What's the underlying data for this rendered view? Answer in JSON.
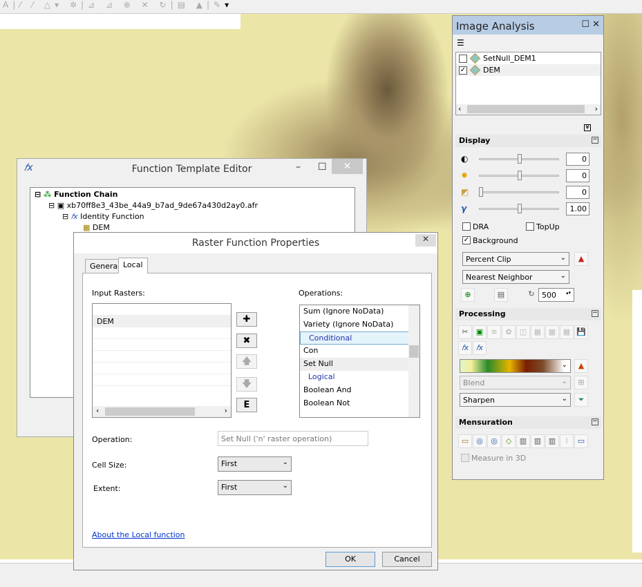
{
  "toolbar": {
    "icons": [
      "text-tool",
      "line-tool",
      "curve-tool",
      "polygon-tool",
      "sparkle-tool",
      "edit-vertices",
      "reshape",
      "move",
      "cut",
      "rotate",
      "attributes",
      "sketch-properties",
      "editor-menu"
    ],
    "overflow": "▾"
  },
  "image_analysis": {
    "title": "Image Analysis",
    "layers": [
      {
        "name": "SetNull_DEM1",
        "checked": false
      },
      {
        "name": "DEM",
        "checked": true
      }
    ],
    "display": {
      "title": "Display",
      "sliders": [
        {
          "name": "contrast",
          "value": "0",
          "level": 0.5
        },
        {
          "name": "brightness",
          "value": "0",
          "level": 0.5
        },
        {
          "name": "transparency",
          "value": "0",
          "level": 0
        },
        {
          "name": "gamma",
          "value": "1.00",
          "level": 0.5
        }
      ],
      "dra_label": "DRA",
      "dra": false,
      "topup_label": "TopUp",
      "topup": false,
      "background_label": "Background",
      "background": true,
      "stretch": "Percent Clip",
      "resampling": "Nearest Neighbor",
      "refresh": "500"
    },
    "processing": {
      "title": "Processing",
      "blend": "Blend",
      "filter": "Sharpen"
    },
    "mensuration": {
      "title": "Mensuration",
      "measure3d_label": "Measure in 3D",
      "measure3d": false
    }
  },
  "fte": {
    "title": "Function Template Editor",
    "tree": [
      "Function Chain",
      "xb70ff8e3_43be_44a9_b7ad_9de67a430d2ay0.afr",
      "Identity Function",
      "DEM"
    ]
  },
  "rfp": {
    "title": "Raster Function Properties",
    "tabs": [
      "General",
      "Local"
    ],
    "active_tab": "Local",
    "input_label": "Input Rasters:",
    "inputs": [
      "DEM"
    ],
    "ops_label": "Operations:",
    "operations": [
      {
        "t": "Sum (Ignore NoData)"
      },
      {
        "t": "Variety (Ignore NoData)"
      },
      {
        "t": "Conditional",
        "group": true
      },
      {
        "t": "Con"
      },
      {
        "t": "Set Null",
        "selected": true
      },
      {
        "t": "Logical",
        "group": true
      },
      {
        "t": "Boolean And"
      },
      {
        "t": "Boolean Not"
      }
    ],
    "buttons": {
      "add": "✚",
      "remove": "✖",
      "up": "🡅",
      "down": "🡇",
      "edit": "E"
    },
    "operation_label": "Operation:",
    "operation_value": "Set Null ('n' raster operation)",
    "cellsize_label": "Cell Size:",
    "cellsize": "First",
    "extent_label": "Extent:",
    "extent": "First",
    "about_link": "About the Local function",
    "ok": "OK",
    "cancel": "Cancel"
  }
}
